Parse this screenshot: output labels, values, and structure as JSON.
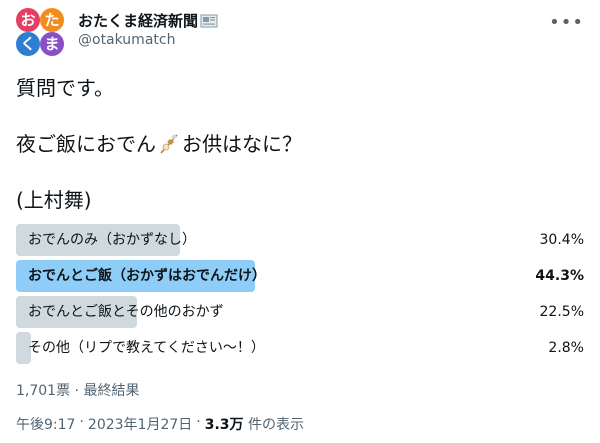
{
  "author": {
    "avatar_chars": [
      "お",
      "た",
      "く",
      "ま"
    ],
    "display_name": "おたくま経済新聞",
    "handle": "@otakumatch"
  },
  "tweet": {
    "line1": "質問です。",
    "line2_before": "夜ご飯におでん",
    "line2_after": "お供はなに？",
    "line3": "(上村舞)"
  },
  "poll": {
    "options": [
      {
        "label": "おでんのみ（おかずなし）",
        "percent_text": "30.4%",
        "percent": 30.4,
        "winner": false
      },
      {
        "label": "おでんとご飯（おかずはおでんだけ）",
        "percent_text": "44.3%",
        "percent": 44.3,
        "winner": true
      },
      {
        "label": "おでんとご飯とその他のおかず",
        "percent_text": "22.5%",
        "percent": 22.5,
        "winner": false
      },
      {
        "label": "その他（リプで教えてください〜！）",
        "percent_text": "2.8%",
        "percent": 2.8,
        "winner": false
      }
    ],
    "votes": "1,701票",
    "separator": "·",
    "status": "最終結果"
  },
  "footer": {
    "time": "午後9:17",
    "sep1": "·",
    "date": "2023年1月27日",
    "sep2": "·",
    "views_count": "3.3万",
    "views_label": "件の表示"
  },
  "colors": {
    "bar": "#cfd9de",
    "bar_winner": "#8ecdf8",
    "secondary_text": "#536471"
  },
  "icons": [
    "newspaper-icon",
    "oden-icon",
    "more-icon"
  ]
}
